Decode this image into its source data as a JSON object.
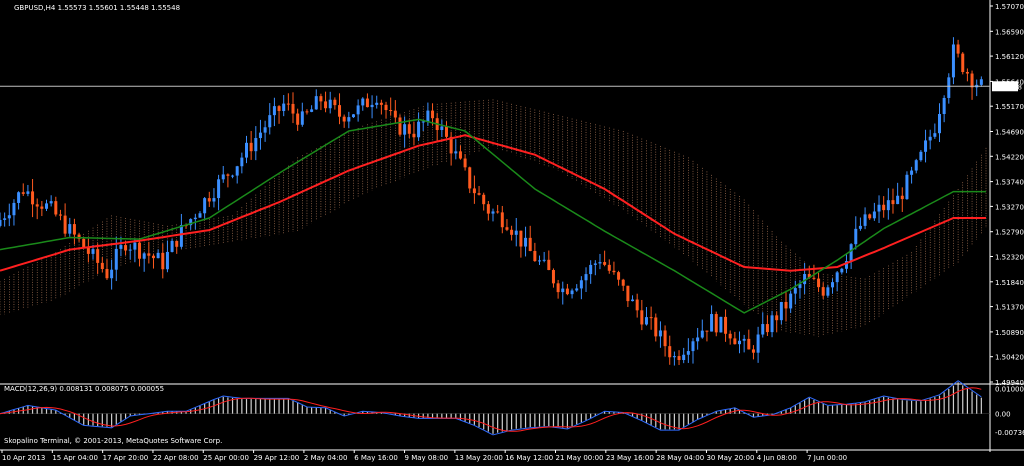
{
  "chart_data": {
    "type": "candlestick",
    "symbol_line": "GBPUSD,H4  1.55573 1.55601 1.55448 1.55548",
    "current_price": "1.55548",
    "y_ticks": [
      "1.57070",
      "1.56590",
      "1.56120",
      "1.55640",
      "1.55170",
      "1.54690",
      "1.54220",
      "1.53740",
      "1.53270",
      "1.52790",
      "1.52320",
      "1.51840",
      "1.51370",
      "1.50890",
      "1.50420",
      "1.49940"
    ],
    "x_ticks": [
      "10 Apr 2013",
      "15 Apr 04:00",
      "17 Apr 20:00",
      "22 Apr 08:00",
      "25 Apr 00:00",
      "29 Apr 12:00",
      "2 May 04:00",
      "6 May 16:00",
      "9 May 08:00",
      "13 May 20:00",
      "16 May 12:00",
      "21 May 00:00",
      "23 May 16:00",
      "28 May 04:00",
      "30 May 20:00",
      "4 Jun 08:00",
      "7 Jun 00:00"
    ],
    "ylim": [
      1.4994,
      1.5707
    ],
    "price_path": [
      [
        0,
        1.529
      ],
      [
        6,
        1.536
      ],
      [
        12,
        1.532
      ],
      [
        18,
        1.526
      ],
      [
        24,
        1.52
      ],
      [
        28,
        1.526
      ],
      [
        32,
        1.524
      ],
      [
        36,
        1.522
      ],
      [
        40,
        1.528
      ],
      [
        46,
        1.535
      ],
      [
        52,
        1.541
      ],
      [
        58,
        1.548
      ],
      [
        62,
        1.552
      ],
      [
        66,
        1.549
      ],
      [
        70,
        1.553
      ],
      [
        74,
        1.55
      ],
      [
        78,
        1.551
      ],
      [
        82,
        1.554
      ],
      [
        86,
        1.548
      ],
      [
        90,
        1.547
      ],
      [
        94,
        1.55
      ],
      [
        98,
        1.544
      ],
      [
        102,
        1.537
      ],
      [
        106,
        1.532
      ],
      [
        110,
        1.53
      ],
      [
        114,
        1.525
      ],
      [
        118,
        1.521
      ],
      [
        122,
        1.517
      ],
      [
        126,
        1.519
      ],
      [
        130,
        1.523
      ],
      [
        134,
        1.518
      ],
      [
        138,
        1.513
      ],
      [
        142,
        1.509
      ],
      [
        146,
        1.504
      ],
      [
        150,
        1.508
      ],
      [
        154,
        1.511
      ],
      [
        158,
        1.509
      ],
      [
        162,
        1.505
      ],
      [
        166,
        1.51
      ],
      [
        170,
        1.514
      ],
      [
        174,
        1.519
      ],
      [
        178,
        1.517
      ],
      [
        182,
        1.522
      ],
      [
        186,
        1.529
      ],
      [
        190,
        1.532
      ],
      [
        194,
        1.534
      ],
      [
        198,
        1.54
      ],
      [
        202,
        1.548
      ],
      [
        206,
        1.562
      ],
      [
        210,
        1.557
      ],
      [
        212,
        1.5555
      ]
    ],
    "bar_count": 212,
    "series": [
      {
        "name": "",
        "color": "#ff2020",
        "values": [
          [
            0,
            1.5205
          ],
          [
            15,
            1.5245
          ],
          [
            30,
            1.5262
          ],
          [
            45,
            1.5282
          ],
          [
            60,
            1.5335
          ],
          [
            75,
            1.5395
          ],
          [
            90,
            1.5442
          ],
          [
            100,
            1.5462
          ],
          [
            115,
            1.5425
          ],
          [
            130,
            1.536
          ],
          [
            145,
            1.5275
          ],
          [
            160,
            1.5212
          ],
          [
            170,
            1.5205
          ],
          [
            180,
            1.5212
          ],
          [
            190,
            1.5248
          ],
          [
            205,
            1.5305
          ]
        ]
      },
      {
        "name": "",
        "color": "#1a8a1a",
        "values": [
          [
            0,
            1.5245
          ],
          [
            15,
            1.5268
          ],
          [
            30,
            1.5265
          ],
          [
            45,
            1.5305
          ],
          [
            60,
            1.539
          ],
          [
            75,
            1.547
          ],
          [
            90,
            1.5492
          ],
          [
            100,
            1.547
          ],
          [
            115,
            1.536
          ],
          [
            130,
            1.528
          ],
          [
            145,
            1.5205
          ],
          [
            160,
            1.5125
          ],
          [
            170,
            1.517
          ],
          [
            180,
            1.5225
          ],
          [
            190,
            1.5285
          ],
          [
            205,
            1.5355
          ]
        ]
      }
    ],
    "cloud": {
      "color": "#f1a77b",
      "upper": [
        [
          0,
          1.5185
        ],
        [
          12,
          1.524
        ],
        [
          24,
          1.531
        ],
        [
          36,
          1.529
        ],
        [
          50,
          1.531
        ],
        [
          64,
          1.542
        ],
        [
          78,
          1.548
        ],
        [
          92,
          1.552
        ],
        [
          106,
          1.553
        ],
        [
          120,
          1.55
        ],
        [
          134,
          1.547
        ],
        [
          148,
          1.542
        ],
        [
          160,
          1.534
        ],
        [
          168,
          1.526
        ],
        [
          176,
          1.52
        ],
        [
          186,
          1.519
        ],
        [
          196,
          1.524
        ],
        [
          206,
          1.536
        ],
        [
          216,
          1.549
        ],
        [
          226,
          1.552
        ]
      ],
      "lower": [
        [
          0,
          1.512
        ],
        [
          12,
          1.515
        ],
        [
          24,
          1.521
        ],
        [
          36,
          1.524
        ],
        [
          50,
          1.526
        ],
        [
          64,
          1.528
        ],
        [
          78,
          1.535
        ],
        [
          92,
          1.54
        ],
        [
          106,
          1.544
        ],
        [
          120,
          1.5395
        ],
        [
          134,
          1.532
        ],
        [
          148,
          1.523
        ],
        [
          160,
          1.514
        ],
        [
          168,
          1.509
        ],
        [
          176,
          1.508
        ],
        [
          186,
          1.51
        ],
        [
          196,
          1.516
        ],
        [
          206,
          1.522
        ],
        [
          216,
          1.533
        ],
        [
          226,
          1.535
        ]
      ]
    },
    "macd": {
      "label": "MACD(12,26,9) 0.008131 0.008075 0.000055",
      "y_ticks": [
        "0.010000",
        "0.00",
        "-0.00736"
      ],
      "ylim": [
        -0.00736,
        0.0115
      ]
    },
    "footer_text": "Skopalino Terminal, © 2001-2013, MetaQuotes Software Corp."
  }
}
